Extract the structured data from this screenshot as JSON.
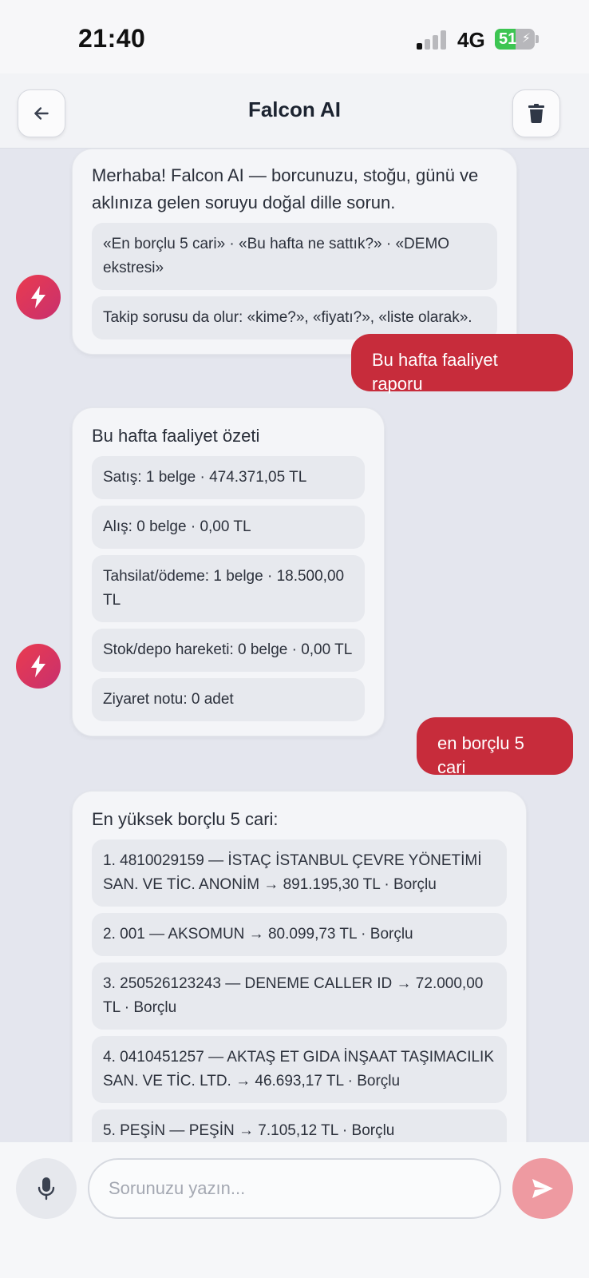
{
  "status": {
    "time": "21:40",
    "network": "4G",
    "battery": "51",
    "battery_level": 0.51
  },
  "header": {
    "title": "Falcon AI",
    "back_icon": "arrow-left-icon",
    "trash_icon": "trash-icon"
  },
  "messages": {
    "welcome": {
      "text": "Merhaba! Falcon AI — borcunuzu, stoğu, günü ve aklınıza gelen soruyu doğal dille sorun.",
      "chips": [
        "«En borçlu 5 cari» · «Bu hafta ne sattık?» · «DEMO ekstresi»",
        "Takip sorusu da olur: «kime?», «fiyatı?», «liste olarak»."
      ]
    },
    "user1": "Bu hafta faaliyet raporu",
    "weekly": {
      "title": "Bu hafta faaliyet özeti",
      "items": [
        "Satış: 1 belge · 474.371,05 TL",
        "Alış: 0 belge · 0,00 TL",
        "Tahsilat/ödeme: 1 belge · 18.500,00 TL",
        "Stok/depo hareketi: 0 belge · 0,00 TL",
        "Ziyaret notu: 0 adet"
      ]
    },
    "user2": "en borçlu 5 cari",
    "debtors": {
      "title": "En yüksek borçlu 5 cari:",
      "items": [
        "1. 4810029159 — İSTAÇ İSTANBUL ÇEVRE YÖNETİMİ SAN. VE TİC. ANONİM → 891.195,30 TL · Borçlu",
        "2. 001 — AKSOMUN → 80.099,73 TL · Borçlu",
        "3. 250526123243 — DENEME CALLER ID → 72.000,00 TL · Borçlu",
        "4. 0410451257 — AKTAŞ ET GIDA İNŞAAT TAŞIMACILIK SAN. VE TİC. LTD. → 46.693,17 TL · Borçlu",
        "5. PEŞİN — PEŞİN → 7.105,12 TL · Borçlu"
      ]
    }
  },
  "composer": {
    "placeholder": "Sorunuzu yazın...",
    "mic_icon": "microphone-icon",
    "send_icon": "send-icon"
  },
  "colors": {
    "accent": "#c72c3b",
    "avatar_gradient": [
      "#ea3b4f",
      "#c8306e"
    ],
    "send_disabled": "#ee9aa1"
  }
}
